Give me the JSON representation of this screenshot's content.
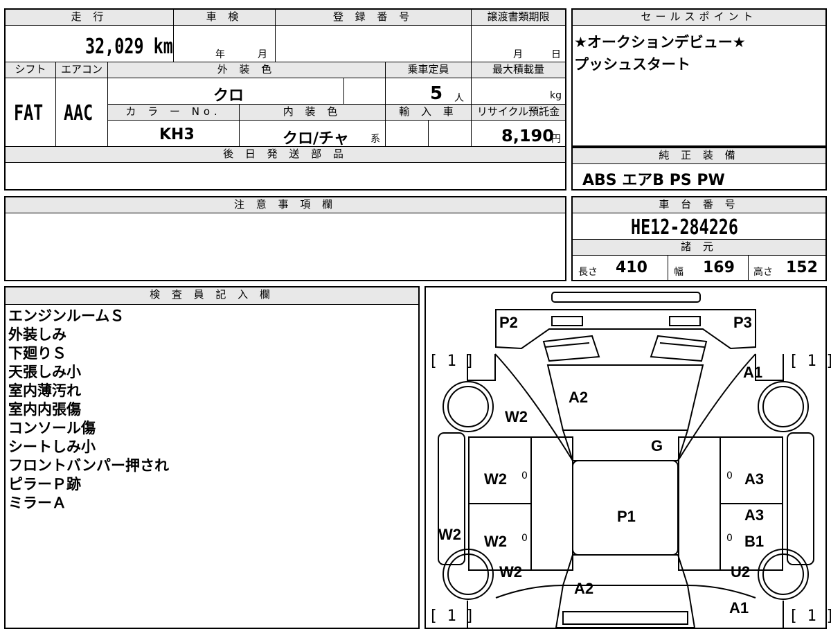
{
  "top": {
    "mileage_label": "走 行",
    "mileage": "32,029 km",
    "inspection_label": "車 検",
    "inspection_year": "年",
    "inspection_month": "月",
    "registration_label": "登 録 番 号",
    "registration": "",
    "transfer_label": "譲渡書類期限",
    "transfer_month": "月",
    "transfer_day": "日",
    "shift_label": "シフト",
    "shift": "FAT",
    "aircon_label": "エアコン",
    "aircon": "AAC",
    "exterior_label": "外 装 色",
    "exterior": "クロ",
    "capacity_label": "乗車定員",
    "capacity": "5",
    "capacity_unit": "人",
    "maxload_label": "最大積載量",
    "maxload_unit": "kg",
    "color_no_label": "カ ラ ー No.",
    "color_no": "KH3",
    "interior_label": "内 装 色",
    "interior": "クロ/チャ",
    "interior_suffix": "系",
    "import_label": "輸 入 車",
    "recycle_label": "リサイクル預託金",
    "recycle": "8,190",
    "recycle_unit": "円",
    "later_parts_label": "後 日 発 送 部 品"
  },
  "sales": {
    "label": "セールスポイント",
    "lines": [
      "★オークションデビュー★",
      "プッシュスタート"
    ]
  },
  "equipment": {
    "label": "純 正 装 備",
    "value": "ABS エアB PS PW"
  },
  "notes": {
    "label": "注 意 事 項 欄"
  },
  "chassis": {
    "label": "車 台 番 号",
    "value": "HE12-284226",
    "spec_label": "諸 元",
    "length_label": "長さ",
    "length": "410",
    "width_label": "幅",
    "width": "169",
    "height_label": "高さ",
    "height": "152"
  },
  "inspector": {
    "label": "検 査 員 記 入 欄",
    "lines": [
      "エンジンルームＳ",
      "外装しみ",
      "下廻りＳ",
      "天張しみ小",
      "室内薄汚れ",
      "室内内張傷",
      "コンソール傷",
      "シートしみ小",
      "フロントバンパー押され",
      "ピラーＰ跡",
      "ミラーＡ"
    ]
  },
  "diagram": {
    "labels": {
      "p2": "P2",
      "p3": "P3",
      "a1_top": "A1",
      "a2_top": "A2",
      "w2_a": "W2",
      "g": "G",
      "w2_b": "W2",
      "a3_a": "A3",
      "p1": "P1",
      "a3_b": "A3",
      "w2_side": "W2",
      "w2_c": "W2",
      "b1": "B1",
      "w2_d": "W2",
      "u2": "U2",
      "a2_bottom": "A2",
      "a1_bottom": "A1",
      "zero1": "0",
      "zero2": "0",
      "zero3": "0",
      "zero4": "0"
    },
    "tires": {
      "front_left": "[ 1 ]",
      "front_right": "[ 1 ]",
      "rear_left": "[ 1 ]",
      "rear_right": "[ 1 ]"
    }
  }
}
